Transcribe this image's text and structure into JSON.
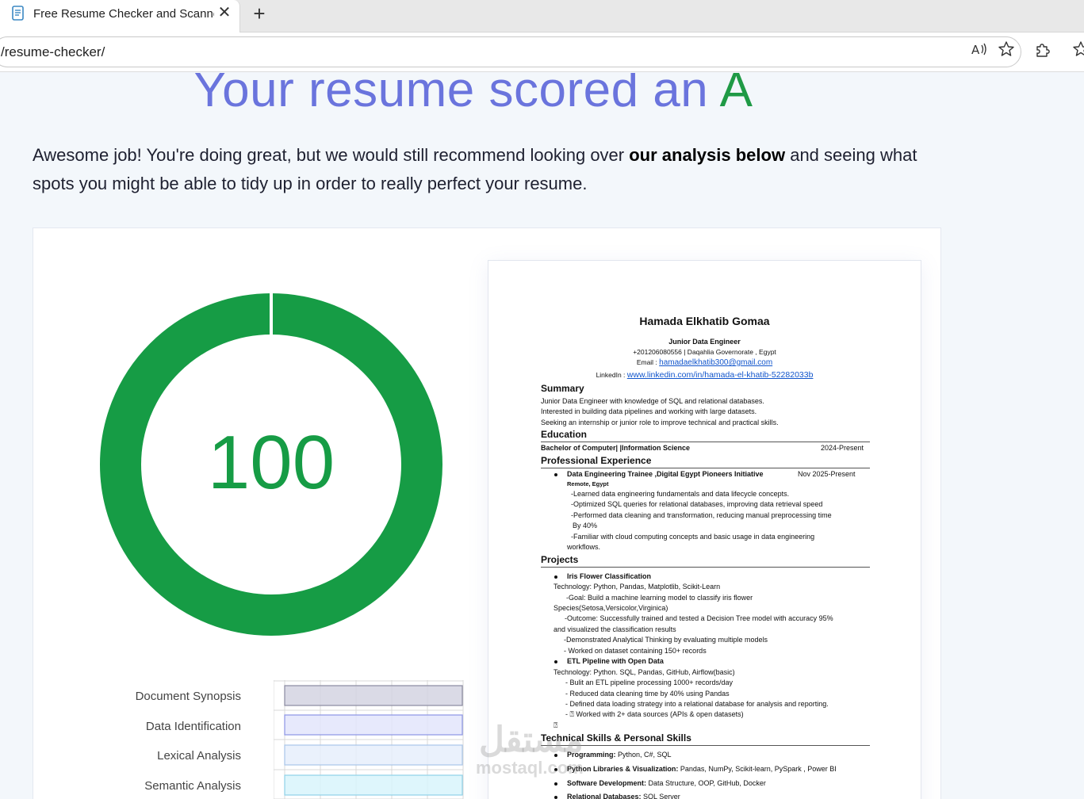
{
  "browser": {
    "tab_title": "Free Resume Checker and Scanner",
    "tab_close": "✕",
    "new_tab": "+",
    "url": "/resume-checker/"
  },
  "page": {
    "headline_prefix": "Your resume scored an",
    "grade": "A",
    "intro_part1": "Awesome job! You're doing great, but we would still recommend looking over",
    "intro_bold": "our analysis below",
    "intro_part2": "and seeing what spots you might be able to tidy up in order to really perfect your resume.",
    "score": "100",
    "score_value": 100,
    "colors": {
      "headline": "#6a74dd",
      "grade": "#1f9a45",
      "gauge": "#169c45"
    }
  },
  "analysis_bars": [
    {
      "label": "Document Synopsis",
      "color": "#d4d4e2",
      "border": "#8a8aa0"
    },
    {
      "label": "Data Identification",
      "color": "#e3e5fb",
      "border": "#8c95e6"
    },
    {
      "label": "Lexical Analysis",
      "color": "#e6effb",
      "border": "#a9c6ea"
    },
    {
      "label": "Semantic Analysis",
      "color": "#d8f4fb",
      "border": "#8fd3e8"
    }
  ],
  "resume": {
    "name": "Hamada Elkhatib Gomaa",
    "title": "Junior Data Engineer",
    "contact": "+201206080556 | Daqahlia Governorate , Egypt",
    "email_label": "Email : ",
    "email": "hamadaelkhatib300@gmail.com",
    "linkedin_label": "LinkedIn : ",
    "linkedin": "www.linkedin.com/in/hamada-el-khatib-52282033b",
    "summary_heading": "Summary",
    "summary_lines": [
      "Junior Data Engineer with knowledge of SQL and relational databases.",
      "Interested in building data pipelines and working with large datasets.",
      "Seeking an internship or junior role to improve technical and practical skills."
    ],
    "education_heading": "Education",
    "education_degree": "Bachelor of Computer| |Information Science",
    "education_date": "2024-Present",
    "experience_heading": "Professional Experience",
    "experience_role": "Data Engineering Trainee ,Digital Egypt Pioneers Initiative",
    "experience_date": "Nov 2025-Present",
    "experience_location": "Remote, Egypt",
    "experience_lines": [
      "-Learned data engineering fundamentals and data lifecycle concepts.",
      "-Optimized SQL queries for relational databases, improving data retrieval speed",
      "-Performed data cleaning and transformation, reducing manual preprocessing time",
      "By 40%",
      "-Familiar with cloud computing concepts and basic usage in data engineering",
      "workflows."
    ],
    "projects_heading": "Projects",
    "project1_title": "Iris Flower Classification",
    "project1_lines": [
      "Technology: Python, Pandas, Matplotlib, Scikit-Learn",
      "-Goal: Build a machine learning model to classify iris flower",
      "Species(Setosa,Versicolor,Virginica)",
      "-Outcome: Successfully trained and tested a Decision Tree model with  accuracy 95%",
      "and visualized the classification results",
      "-Demonstrated Analytical Thinking by evaluating multiple models",
      "- Worked on dataset containing 150+ records"
    ],
    "project2_title": "ETL Pipeline with Open Data",
    "project2_lines": [
      "Technology: Python. SQL, Pandas, GitHub, Airflow(basic)",
      "- Bulit an ETL pipeline processing 1000+  records/day",
      "- Reduced data cleaning time by 40% using Pandas",
      "- Defined data loading strategy into a relational database for analysis and reporting.",
      "- ⍰  Worked with 2+ data sources (APIs & open datasets)",
      "⍰"
    ],
    "skills_heading": "Technical Skills & Personal Skills",
    "skills": [
      {
        "label": "Programming:",
        "value": " Python, C#, SQL"
      },
      {
        "label": "Python Libraries & Visualization:",
        "value": " Pandas, NumPy, Scikit-learn, PySpark , Power BI"
      },
      {
        "label": "Software Development:",
        "value": " Data Structure, OOP, GitHub, Docker"
      },
      {
        "label": "Relational Databases:",
        "value": " SQL Server"
      }
    ]
  },
  "watermark": {
    "arabic": "مستقل",
    "latin": "mostaql.com"
  }
}
